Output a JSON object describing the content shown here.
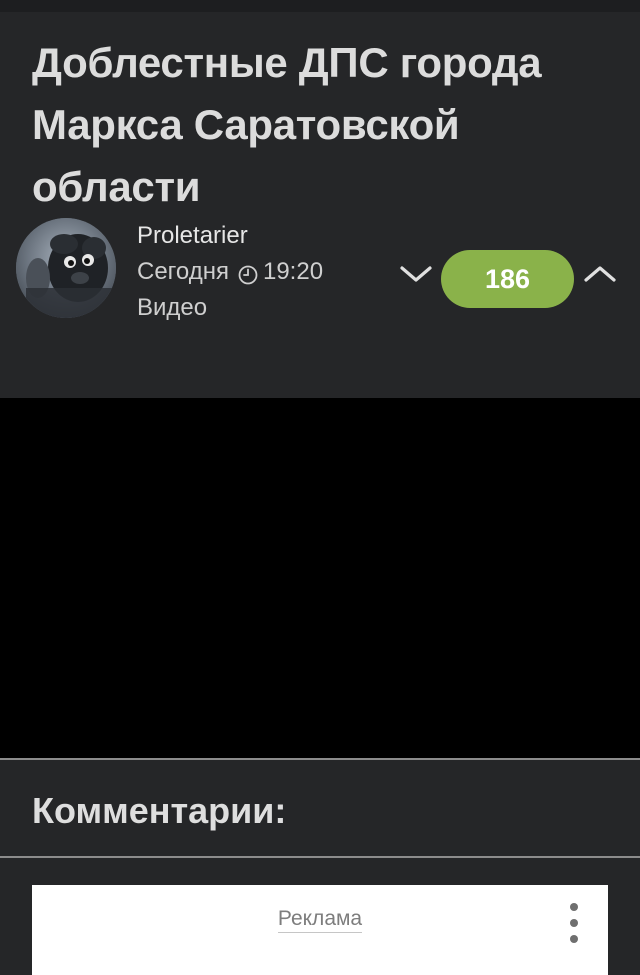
{
  "post": {
    "title": "Доблестные ДПС города Маркса Саратовской области",
    "author": "Proletarier",
    "date": "Сегодня",
    "time": "19:20",
    "category": "Видео",
    "rating": "186",
    "rating_color": "#8ab24a",
    "vote_down_icon": "chevron-down-icon",
    "vote_up_icon": "chevron-up-icon"
  },
  "video": {
    "background": "#000000"
  },
  "comments": {
    "title": "Комментарии:"
  },
  "ad": {
    "label": "Реклама",
    "menu_icon": "more-vertical-icon"
  }
}
